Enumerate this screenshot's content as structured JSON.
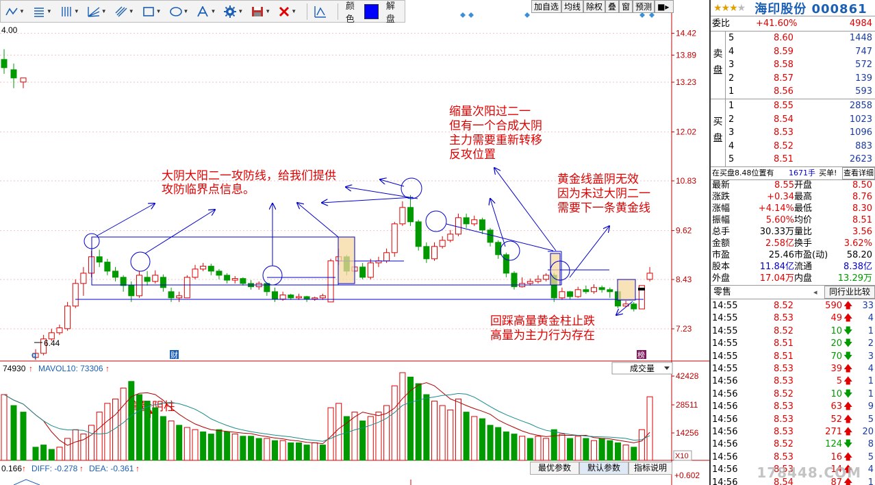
{
  "toolbar": {
    "color_label": "颜色",
    "unlock_label": "解盘",
    "color_value": "#0000ff"
  },
  "chart_tabs": [
    "加自选",
    "均线",
    "除权",
    "叠",
    "窗",
    "预测"
  ],
  "price_axis": [
    "14.42",
    "13.89",
    "13.23",
    "12.02",
    "10.83",
    "9.62",
    "8.43",
    "7.23"
  ],
  "volume_axis": [
    "42428",
    "28511",
    "14256"
  ],
  "volume_unit": "X10",
  "macd_axis": "+0.602",
  "chart_labels": {
    "top_left_price": "4.00",
    "low_marker": "6.44",
    "q_marker": "q",
    "cai_marker": "财",
    "bang_marker": "榜"
  },
  "annotations": {
    "a1_line1": "大阴大阳二一攻防线，给我们提供",
    "a1_line2": "攻防临界点信息。",
    "a2_line1": "缩量次阳过二一",
    "a2_line2": "但有一个合成大阴",
    "a2_line3": "主力需要重新转移",
    "a2_line4": "反攻位置",
    "a3_line1": "黄金线盖阴无效",
    "a3_line2": "因为未过大阴二一",
    "a3_line3": "需要下一条黄金线",
    "a4_line1": "回踩高量黄金柱止跌",
    "a4_line2": "高量为主力行为存在",
    "a5": "高量阴柱"
  },
  "volume_header": {
    "vol_value": "74930",
    "mavol_label": "MAVOL10: 73306",
    "dropdown": "成交量"
  },
  "macd_header": {
    "macd_value": "0.166",
    "diff_label": "DIFF: -0.278",
    "dea_label": "DEA: -0.361"
  },
  "indicator_tabs": [
    "最优参数",
    "默认参数",
    "指标说明"
  ],
  "colors": {
    "up": "#e00000",
    "down": "#009900",
    "annot": "#0000cc",
    "grid": "#c00000"
  },
  "chart_data": {
    "type": "candlestick",
    "candles": [
      [
        13.75,
        13.55,
        14.0,
        13.4
      ],
      [
        13.5,
        13.3,
        13.65,
        13.05
      ],
      [
        13.2,
        13.3,
        13.3,
        13.05
      ],
      [
        6.5,
        6.6,
        6.7,
        6.44
      ],
      [
        6.6,
        6.95,
        7.05,
        6.55
      ],
      [
        6.95,
        7.1,
        7.2,
        6.9
      ],
      [
        7.1,
        7.22,
        7.3,
        7.05
      ],
      [
        7.2,
        7.75,
        7.85,
        7.15
      ],
      [
        7.75,
        8.3,
        8.4,
        7.7
      ],
      [
        8.3,
        8.55,
        8.7,
        8.0
      ],
      [
        8.55,
        8.95,
        9.1,
        8.45
      ],
      [
        8.95,
        8.82,
        9.12,
        8.7
      ],
      [
        8.82,
        8.6,
        8.9,
        8.5
      ],
      [
        8.6,
        8.45,
        8.7,
        8.35
      ],
      [
        8.45,
        8.25,
        8.5,
        8.1
      ],
      [
        8.25,
        8.0,
        8.35,
        7.85
      ],
      [
        8.0,
        8.5,
        8.6,
        7.95
      ],
      [
        8.45,
        8.35,
        8.6,
        8.25
      ],
      [
        8.35,
        8.5,
        8.62,
        8.3
      ],
      [
        8.45,
        8.2,
        8.52,
        8.1
      ],
      [
        8.1,
        7.95,
        8.2,
        7.85
      ],
      [
        7.95,
        8.0,
        8.1,
        7.85
      ],
      [
        7.95,
        8.45,
        8.5,
        7.95
      ],
      [
        8.45,
        8.65,
        8.75,
        8.4
      ],
      [
        8.65,
        8.72,
        8.8,
        8.6
      ],
      [
        8.72,
        8.6,
        8.78,
        8.5
      ],
      [
        8.6,
        8.5,
        8.65,
        8.4
      ],
      [
        8.5,
        8.38,
        8.55,
        8.3
      ],
      [
        8.38,
        8.42,
        8.48,
        8.3
      ],
      [
        8.42,
        8.3,
        8.45,
        8.25
      ],
      [
        8.3,
        8.22,
        8.38,
        8.15
      ],
      [
        8.22,
        8.3,
        8.35,
        8.15
      ],
      [
        8.3,
        8.1,
        8.32,
        8.0
      ],
      [
        8.1,
        7.92,
        8.2,
        7.85
      ],
      [
        7.92,
        8.02,
        8.1,
        7.88
      ],
      [
        8.02,
        7.95,
        8.05,
        7.9
      ],
      [
        7.95,
        7.98,
        8.05,
        7.9
      ],
      [
        7.98,
        7.92,
        8.0,
        7.85
      ],
      [
        7.92,
        7.95,
        7.98,
        7.88
      ],
      [
        7.95,
        8.0,
        8.05,
        7.9
      ],
      [
        7.85,
        8.85,
        8.9,
        7.85
      ],
      [
        8.85,
        8.95,
        9.15,
        8.75
      ],
      [
        8.95,
        8.6,
        9.0,
        8.5
      ],
      [
        8.6,
        8.7,
        8.85,
        8.5
      ],
      [
        8.7,
        8.45,
        8.8,
        8.4
      ],
      [
        8.45,
        8.8,
        8.9,
        8.4
      ],
      [
        8.8,
        8.85,
        8.95,
        8.7
      ],
      [
        8.85,
        9.05,
        9.15,
        8.8
      ],
      [
        9.05,
        9.75,
        9.8,
        8.95
      ],
      [
        9.75,
        10.15,
        10.3,
        9.7
      ],
      [
        10.15,
        9.8,
        10.45,
        9.7
      ],
      [
        9.8,
        9.2,
        9.85,
        9.1
      ],
      [
        9.2,
        8.9,
        9.3,
        8.8
      ],
      [
        8.9,
        9.2,
        9.3,
        8.85
      ],
      [
        9.2,
        9.35,
        9.45,
        9.15
      ],
      [
        9.35,
        9.5,
        9.6,
        9.3
      ],
      [
        9.5,
        9.9,
        10.0,
        9.45
      ],
      [
        9.9,
        9.75,
        10.0,
        9.65
      ],
      [
        9.75,
        9.85,
        9.95,
        9.7
      ],
      [
        9.85,
        9.6,
        9.9,
        9.5
      ],
      [
        9.6,
        9.3,
        9.65,
        9.2
      ],
      [
        9.3,
        9.0,
        9.35,
        8.9
      ],
      [
        9.0,
        8.55,
        9.05,
        8.45
      ],
      [
        8.55,
        8.22,
        8.6,
        8.15
      ],
      [
        8.22,
        8.3,
        8.45,
        8.2
      ],
      [
        8.3,
        8.35,
        8.42,
        8.25
      ],
      [
        8.35,
        8.4,
        8.5,
        8.3
      ],
      [
        8.4,
        8.5,
        8.55,
        8.35
      ],
      [
        8.5,
        7.95,
        8.55,
        7.85
      ],
      [
        7.95,
        8.1,
        8.2,
        7.9
      ],
      [
        8.1,
        7.98,
        8.12,
        7.92
      ],
      [
        7.98,
        8.15,
        8.22,
        7.95
      ],
      [
        8.15,
        8.1,
        8.25,
        8.05
      ],
      [
        8.1,
        8.2,
        8.28,
        8.05
      ],
      [
        8.2,
        8.15,
        8.25,
        8.08
      ],
      [
        8.15,
        8.1,
        8.2,
        7.95
      ],
      [
        8.1,
        7.75,
        8.15,
        7.7
      ],
      [
        7.75,
        7.8,
        7.88,
        7.72
      ],
      [
        7.8,
        7.68,
        7.85,
        7.62
      ],
      [
        7.68,
        8.25,
        8.25,
        7.68
      ],
      [
        8.4,
        8.55,
        8.7,
        8.35
      ]
    ],
    "volume": [
      [
        30,
        1
      ],
      [
        25,
        0
      ],
      [
        22,
        0
      ],
      [
        6,
        0
      ],
      [
        7,
        0
      ],
      [
        5,
        0
      ],
      [
        6,
        1
      ],
      [
        10,
        1
      ],
      [
        14,
        1
      ],
      [
        12,
        1
      ],
      [
        16,
        1
      ],
      [
        22,
        1
      ],
      [
        26,
        1
      ],
      [
        28,
        1
      ],
      [
        33,
        1
      ],
      [
        36,
        0
      ],
      [
        30,
        0
      ],
      [
        27,
        0
      ],
      [
        24,
        0
      ],
      [
        20,
        0
      ],
      [
        18,
        1
      ],
      [
        16,
        0
      ],
      [
        15,
        1
      ],
      [
        14,
        1
      ],
      [
        13,
        0
      ],
      [
        12,
        0
      ],
      [
        14,
        0
      ],
      [
        13,
        0
      ],
      [
        12,
        1
      ],
      [
        11,
        0
      ],
      [
        11,
        0
      ],
      [
        10,
        0
      ],
      [
        10,
        1
      ],
      [
        9,
        0
      ],
      [
        9,
        1
      ],
      [
        8,
        0
      ],
      [
        8,
        0
      ],
      [
        7,
        0
      ],
      [
        8,
        1
      ],
      [
        7,
        0
      ],
      [
        24,
        1
      ],
      [
        26,
        1
      ],
      [
        20,
        0
      ],
      [
        22,
        1
      ],
      [
        18,
        0
      ],
      [
        20,
        1
      ],
      [
        22,
        1
      ],
      [
        25,
        1
      ],
      [
        34,
        1
      ],
      [
        40,
        1
      ],
      [
        38,
        0
      ],
      [
        35,
        0
      ],
      [
        30,
        0
      ],
      [
        27,
        1
      ],
      [
        25,
        1
      ],
      [
        23,
        1
      ],
      [
        28,
        1
      ],
      [
        22,
        0
      ],
      [
        20,
        1
      ],
      [
        19,
        0
      ],
      [
        16,
        0
      ],
      [
        15,
        0
      ],
      [
        13,
        0
      ],
      [
        12,
        0
      ],
      [
        11,
        1
      ],
      [
        10,
        0
      ],
      [
        11,
        1
      ],
      [
        10,
        1
      ],
      [
        14,
        0
      ],
      [
        12,
        1
      ],
      [
        10,
        0
      ],
      [
        11,
        1
      ],
      [
        10,
        0
      ],
      [
        9,
        1
      ],
      [
        10,
        0
      ],
      [
        9,
        0
      ],
      [
        8,
        0
      ],
      [
        7,
        1
      ],
      [
        6,
        0
      ],
      [
        14,
        1
      ],
      [
        29,
        1
      ]
    ]
  },
  "rp": {
    "stock_name": "海印股份 000861",
    "wb_label": "委比",
    "wb_pct": "+41.60%",
    "wb_value": "4984",
    "sell_label": [
      "卖",
      "盘"
    ],
    "buy_label": [
      "买",
      "盘"
    ],
    "sells": [
      {
        "lvl": "5",
        "price": "8.60",
        "vol": "1448"
      },
      {
        "lvl": "4",
        "price": "8.59",
        "vol": "747"
      },
      {
        "lvl": "3",
        "price": "8.58",
        "vol": "572"
      },
      {
        "lvl": "2",
        "price": "8.57",
        "vol": "139"
      },
      {
        "lvl": "1",
        "price": "8.56",
        "vol": "593"
      }
    ],
    "buys": [
      {
        "lvl": "1",
        "price": "8.55",
        "vol": "2858"
      },
      {
        "lvl": "2",
        "price": "8.54",
        "vol": "1023"
      },
      {
        "lvl": "3",
        "price": "8.53",
        "vol": "1096"
      },
      {
        "lvl": "4",
        "price": "8.52",
        "vol": "883"
      },
      {
        "lvl": "5",
        "price": "8.51",
        "vol": "2623"
      }
    ],
    "order_note": "在买盘8.48位置有",
    "order_vol": "1671手",
    "order_type": "买单!",
    "order_detail": "查看详细",
    "quote": [
      {
        "k1": "最新",
        "v1": "8.55",
        "c1": "red",
        "k2": "开盘",
        "v2": "8.50",
        "c2": "red"
      },
      {
        "k1": "涨跌",
        "v1": "+0.34",
        "c1": "red",
        "k2": "最高",
        "v2": "8.76",
        "c2": "red"
      },
      {
        "k1": "涨幅",
        "v1": "+4.14%",
        "c1": "red",
        "k2": "最低",
        "v2": "8.30",
        "c2": "red"
      },
      {
        "k1": "振幅",
        "v1": "5.60%",
        "c1": "red",
        "k2": "均价",
        "v2": "8.51",
        "c2": "red"
      },
      {
        "k1": "总手",
        "v1": "30.33万",
        "c1": "dk",
        "k2": "量比",
        "v2": "3.56",
        "c2": "red"
      },
      {
        "k1": "金额",
        "v1": "2.58亿",
        "c1": "red",
        "k2": "换手",
        "v2": "3.62%",
        "c2": "red"
      },
      {
        "k1": "市盈",
        "v1": "25.46",
        "c1": "dk",
        "k2": "市盈(动)",
        "v2": "58.20",
        "c2": "dk"
      },
      {
        "k1": "股本",
        "v1": "11.84亿",
        "c1": "blue",
        "k2": "流通",
        "v2": "8.38亿",
        "c2": "blue"
      },
      {
        "k1": "外盘",
        "v1": "17.04万",
        "c1": "red",
        "k2": "内盘",
        "v2": "13.29万",
        "c2": "green"
      }
    ],
    "tick_tab_left": "零售",
    "tick_tab_right": "同行业比较",
    "ticks": [
      {
        "t": "14:55",
        "p": "8.52",
        "v": "590",
        "d": "up",
        "n": "33"
      },
      {
        "t": "14:55",
        "p": "8.53",
        "v": "49",
        "d": "up",
        "n": "4"
      },
      {
        "t": "14:55",
        "p": "8.52",
        "v": "10",
        "d": "down",
        "n": "1"
      },
      {
        "t": "14:55",
        "p": "8.51",
        "v": "20",
        "d": "down",
        "n": "2"
      },
      {
        "t": "14:55",
        "p": "8.51",
        "v": "70",
        "d": "down",
        "n": "3"
      },
      {
        "t": "14:55",
        "p": "8.53",
        "v": "39",
        "d": "up",
        "n": "4"
      },
      {
        "t": "14:56",
        "p": "8.53",
        "v": "5",
        "d": "up",
        "n": "1"
      },
      {
        "t": "14:56",
        "p": "8.52",
        "v": "10",
        "d": "down",
        "n": "1"
      },
      {
        "t": "14:56",
        "p": "8.53",
        "v": "63",
        "d": "up",
        "n": "9"
      },
      {
        "t": "14:56",
        "p": "8.53",
        "v": "52",
        "d": "up",
        "n": "5"
      },
      {
        "t": "14:56",
        "p": "8.53",
        "v": "271",
        "d": "up",
        "n": "20"
      },
      {
        "t": "14:56",
        "p": "8.52",
        "v": "124",
        "d": "down",
        "n": "8"
      },
      {
        "t": "14:56",
        "p": "8.53",
        "v": "16",
        "d": "up",
        "n": "5"
      },
      {
        "t": "14:56",
        "p": "8.53",
        "v": "14",
        "d": "up",
        "n": "4"
      },
      {
        "t": "14:56",
        "p": "8.54",
        "v": "87",
        "d": "up",
        "n": "1"
      }
    ],
    "watermark": "178448.COM"
  }
}
